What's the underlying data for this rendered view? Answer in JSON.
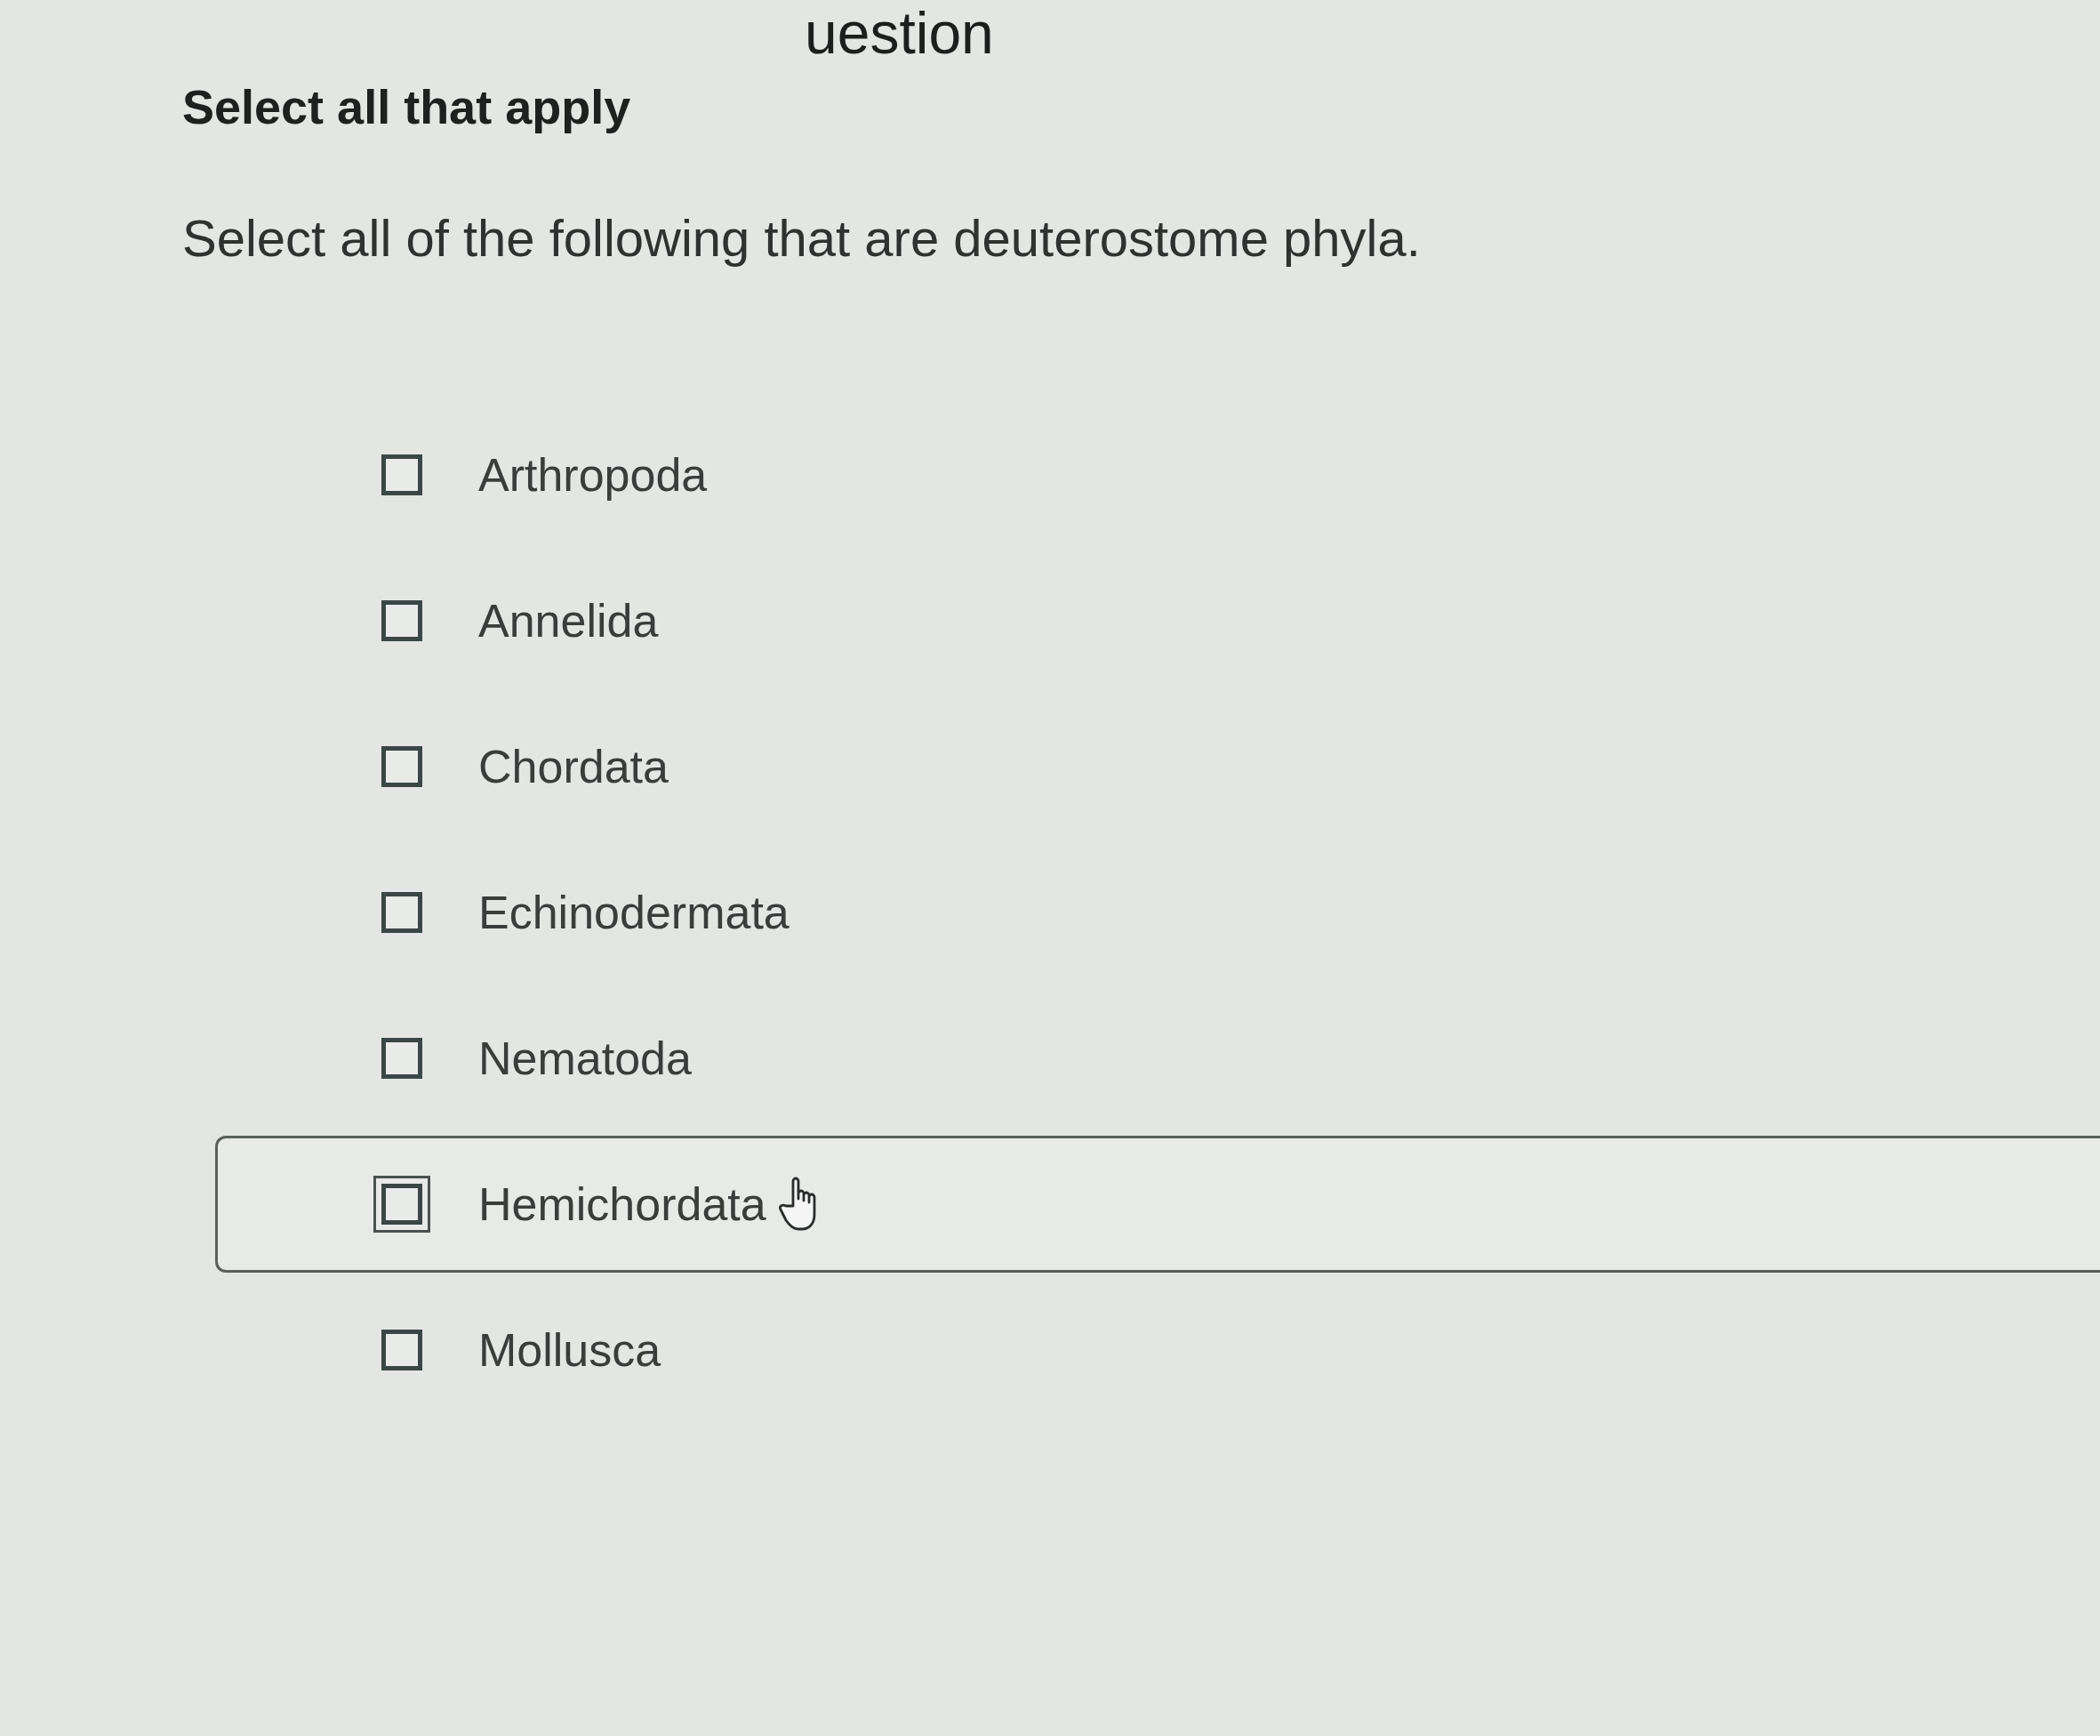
{
  "header": {
    "title": "uestion"
  },
  "instruction": "Select all that apply",
  "question": "Select all of the following that are deuterostome phyla.",
  "options": [
    {
      "label": "Arthropoda",
      "checked": false,
      "focused": false
    },
    {
      "label": "Annelida",
      "checked": false,
      "focused": false
    },
    {
      "label": "Chordata",
      "checked": false,
      "focused": false
    },
    {
      "label": "Echinodermata",
      "checked": false,
      "focused": false
    },
    {
      "label": "Nematoda",
      "checked": false,
      "focused": false
    },
    {
      "label": "Hemichordata",
      "checked": false,
      "focused": true
    },
    {
      "label": "Mollusca",
      "checked": false,
      "focused": false
    }
  ]
}
